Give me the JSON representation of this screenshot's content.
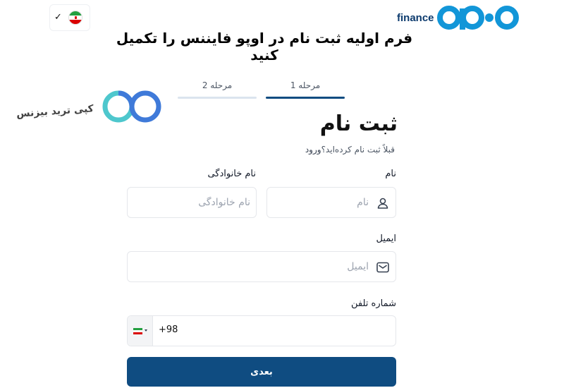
{
  "header": {
    "language_check": "✓",
    "brand_text": "finance",
    "brand_logo_name": "opo-logo",
    "overlay_title": "فرم اولیه ثبت نام در اوپو فایننس را تکمیل کنید"
  },
  "watermark": {
    "text": "کپی ترید بیزنس",
    "logo_name": "infinity-logo"
  },
  "steps": [
    {
      "label": "مرحله 1",
      "active": true
    },
    {
      "label": "مرحله 2",
      "active": false
    }
  ],
  "form": {
    "title": "ثبت نام",
    "already_registered": "قبلاً ثبت نام کرده‌اید؟",
    "login_link": "ورود",
    "first_name": {
      "label": "نام",
      "placeholder": "نام",
      "icon": "user-icon"
    },
    "last_name": {
      "label": "نام خانوادگی",
      "placeholder": "نام خانوادگی"
    },
    "email": {
      "label": "ایمیل",
      "placeholder": "ایمیل",
      "icon": "mail-icon"
    },
    "phone": {
      "label": "شماره تلفن",
      "country_code": "+98",
      "country_flag": "iran-flag-icon"
    },
    "next_button": "بعدی"
  },
  "colors": {
    "primary": "#0f4c81",
    "brand_blue": "#1296d8",
    "step_inactive": "#dbe4ee",
    "watermark_blue": "#2f6fd6",
    "watermark_cyan": "#3fc3c9"
  }
}
